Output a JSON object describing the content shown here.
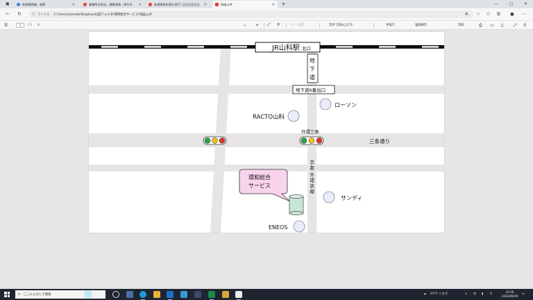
{
  "tabs": [
    {
      "label": "新規通常編 - 検索",
      "color": "#4a7fd9"
    },
    {
      "label": "事業所を取ね、健康保険・厚生年",
      "color": "#e0442a"
    },
    {
      "label": "新規通常申請を実行! 日日日日日日",
      "color": "#e0442a"
    },
    {
      "label": "地図.pdf",
      "color": "#d83b2b"
    }
  ],
  "address": {
    "file_label": "ファイル",
    "url": "C:/Users/yamada/Dropbox/山田フォルダ/環和総合サービス/地図.pdf"
  },
  "pdf_toolbar": {
    "page_current": "1",
    "page_total": "/ 1",
    "page_view": "ページ表示",
    "read_aloud": "音声で読み上げる",
    "draw": "手描き",
    "highlight": "強調表示",
    "erase": "消去"
  },
  "map": {
    "station": "JR山科駅",
    "station_exit": "北口",
    "underground": [
      "地",
      "下",
      "道"
    ],
    "exit6": "地下道6番出口",
    "racto": "RACTO山科",
    "lawson": "ローソン",
    "intersection": "外環三条",
    "sanjo_street": "三条通り",
    "kyoto_ring": [
      "京",
      "都",
      "外",
      "環",
      "状",
      "線"
    ],
    "callout_line1": "環和総合",
    "callout_line2": "サービス",
    "sandy": "サンディ",
    "eneos": "ENEOS",
    "colors": {
      "signal_green": "#2aa14a",
      "signal_yellow": "#f2c21b",
      "signal_red": "#e0342a",
      "callout_fill": "#f9d3ec",
      "building_fill": "#c8e6d6"
    }
  },
  "taskbar": {
    "search_placeholder": "ここに入力して検索",
    "weather": "23°C くもり",
    "time": "10:18",
    "date": "2022/09/29"
  }
}
